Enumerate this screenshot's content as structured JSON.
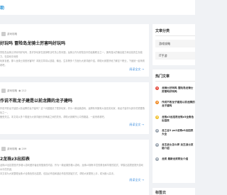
{
  "header": {
    "brand": "助"
  },
  "articles": [
    {
      "avatar_icon": "avatar-icon",
      "category": "游戏攻略",
      "views": "",
      "title": "好玩吗 冒险岛龙骑士厉害吗好玩吗",
      "excerpt_lines": [
        "冒险岛龙骑士好玩吗好玩吗，是许多玩家在选择职业时关心的问题，龙骑士作为冒险岛中的经典职业之一，拥有强大的输出能力和出色的生存能力，在游戏中深受",
        "玩家喜爱。那么龙骑士到底厉害吗？本篇文章将从技能、输出、生存等多个方面为大家详细介绍，帮助大家更好地了解这个职业，下面就一起来看看吧。"
      ],
      "read_more": "阅读全文 →"
    },
    {
      "avatar_icon": "avatar-icon",
      "category": "游戏攻略",
      "views": "212",
      "title": "作说不败龙子建是以前龙腾的龙子建吗",
      "excerpt_lines": [
        "作说不败龙子建是以前龙腾的龙子建吗？这个问题困扰了很多玩家，作为一款经典游戏，龙腾系列拥有大量忠实玩家，而龙子建作为其中的重要角色之一，",
        "备受关注。本文将从多个角度为大家详细分析两者之间的关系，帮助大家解开心中的疑惑，一起来看看吧。"
      ],
      "read_more": "阅读全文 →"
    },
    {
      "avatar_icon": "avatar-icon",
      "category": "游戏攻略",
      "views": "209",
      "title": "2龙珠z3出招表",
      "excerpt_lines": [
        "龙珠z3出招表是许多格斗游戏爱好者经常搜索的内容，作为一款经典的格斗游戏，龙珠z3拥有丰富的角色和华丽的招式，掌握出招表是提升游戏水平的关键，",
        "本文将为大家整理龙珠z3全角色的出招表，包括必杀技和超必杀技的按键方式，帮助大家更快上手，成为格斗高手。"
      ],
      "read_more": "阅读全文 →"
    }
  ],
  "sidebar": {
    "categories_title": "文章分类",
    "categories": [
      "游戏攻略",
      "IT手游"
    ],
    "hot_title": "热门文章",
    "hot": [
      {
        "rank": "1",
        "color": "#e5483b",
        "title": "龙骑士好玩吗 冒险岛龙骑士厉害吗好玩吗"
      },
      {
        "rank": "2",
        "color": "#f08a24",
        "title": "作说不败龙子建是以前龙腾的龙子建吗"
      },
      {
        "rank": "3",
        "color": "#f2c12e",
        "title": "龙珠z3出招表龙珠z3全角色出招表"
      },
      {
        "rank": "4",
        "color": "#9aa4af",
        "title": "龙之谷2 ps2龙珠z3出招表大全"
      },
      {
        "rank": "5",
        "color": "#9aa4af",
        "title": "龙王战士怎么样 龙王战士技能介绍"
      },
      {
        "rank": "6",
        "color": "#9aa4af",
        "title": "龙武 最新龙武职业介绍"
      }
    ],
    "tags_title": "标签云"
  }
}
